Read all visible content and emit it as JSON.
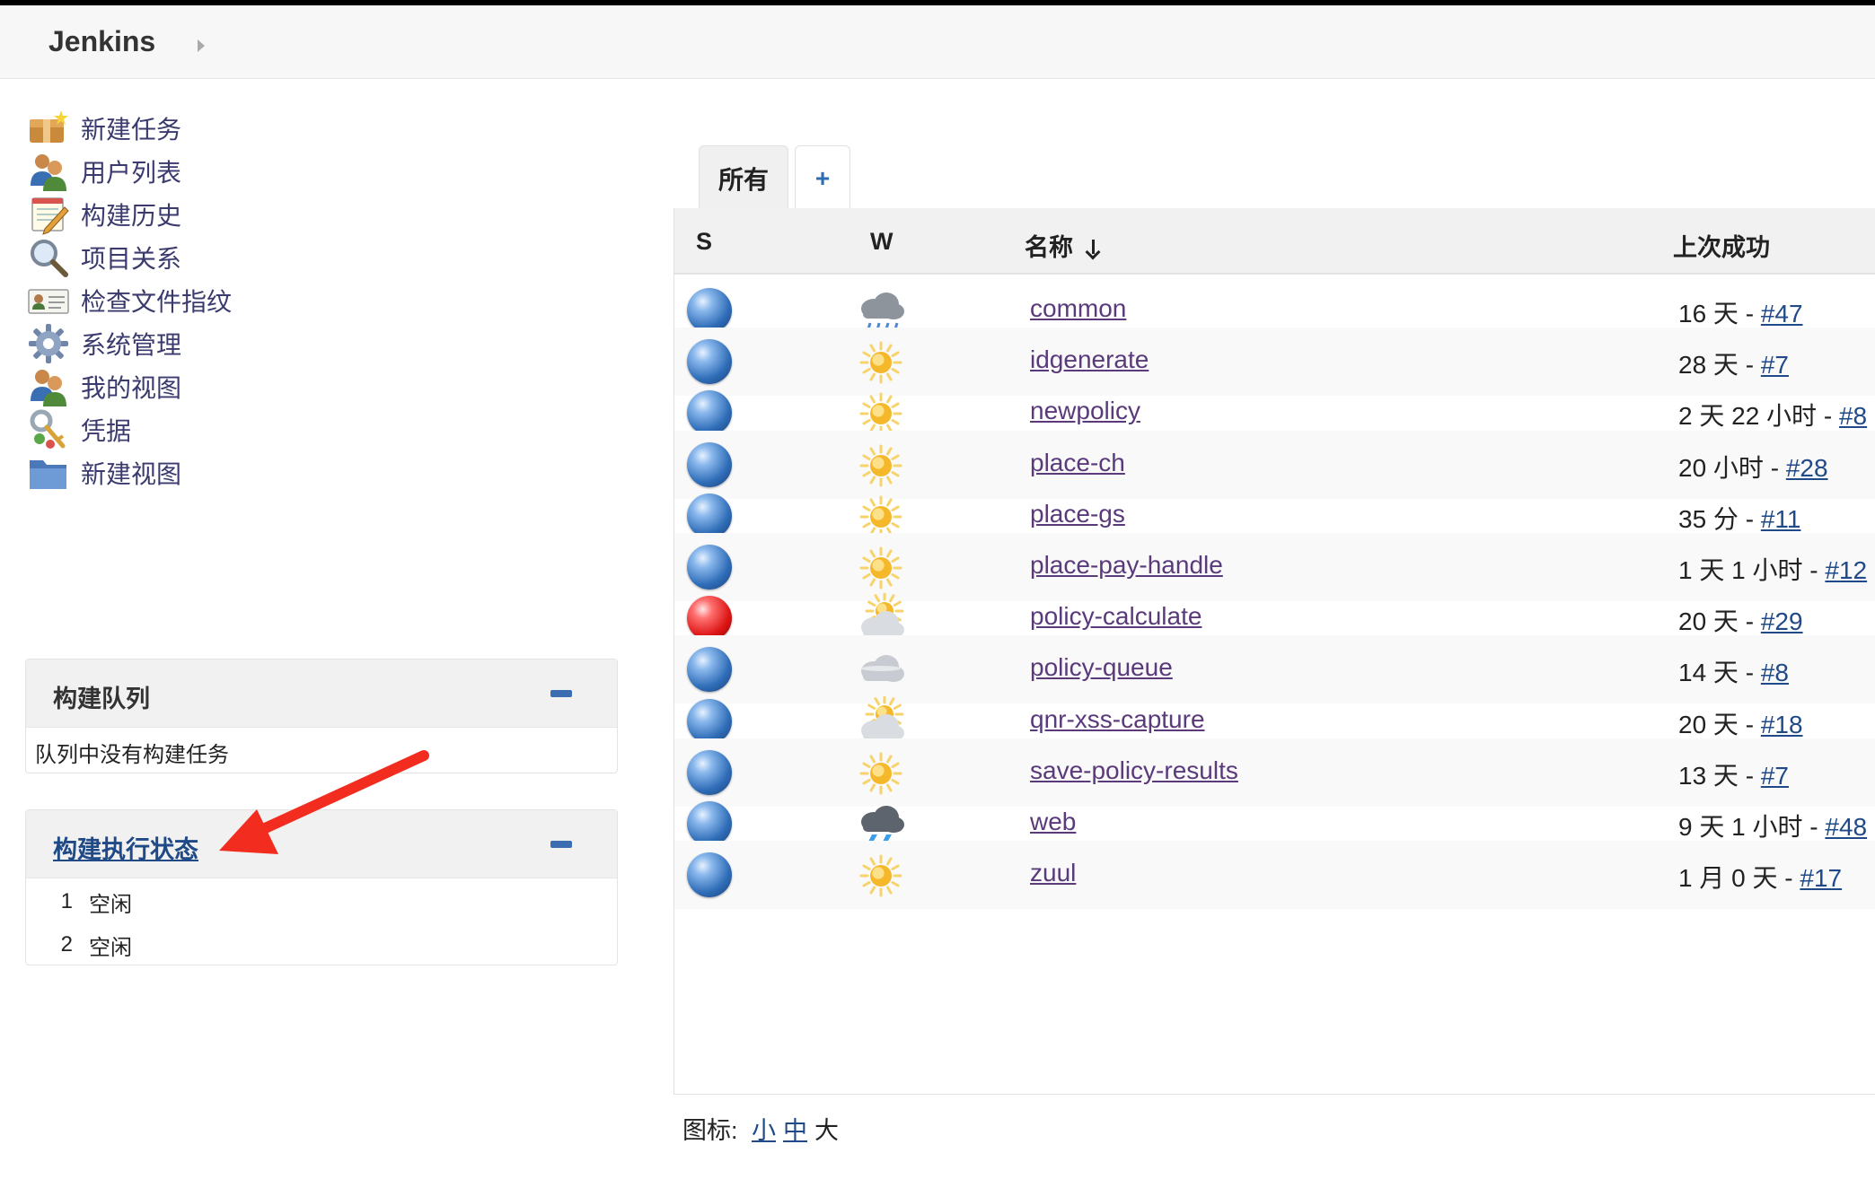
{
  "header": {
    "brand": "Jenkins"
  },
  "sidebar": {
    "tasks": [
      {
        "label": "新建任务",
        "icon": "new-item-icon"
      },
      {
        "label": "用户列表",
        "icon": "users-icon"
      },
      {
        "label": "构建历史",
        "icon": "notepad-icon"
      },
      {
        "label": "项目关系",
        "icon": "magnifier-icon"
      },
      {
        "label": "检查文件指纹",
        "icon": "fingerprint-card-icon"
      },
      {
        "label": "系统管理",
        "icon": "gear-icon"
      },
      {
        "label": "我的视图",
        "icon": "user-view-icon"
      },
      {
        "label": "凭据",
        "icon": "keys-icon"
      },
      {
        "label": "新建视图",
        "icon": "folder-icon"
      }
    ]
  },
  "build_queue": {
    "title": "构建队列",
    "empty_text": "队列中没有构建任务"
  },
  "executors": {
    "title": "构建执行状态",
    "items": [
      {
        "num": "1",
        "status": "空闲"
      },
      {
        "num": "2",
        "status": "空闲"
      }
    ]
  },
  "tabs": {
    "active": "所有",
    "add": "+"
  },
  "table": {
    "headers": {
      "s": "S",
      "w": "W",
      "name": "名称",
      "last_success": "上次成功"
    },
    "rows": [
      {
        "status": "blue",
        "weather": "rain",
        "name": "common",
        "last_time": "16 天 - ",
        "last_build": "#47"
      },
      {
        "status": "blue",
        "weather": "sunny",
        "name": "idgenerate",
        "last_time": "28 天 - ",
        "last_build": "#7"
      },
      {
        "status": "blue",
        "weather": "sunny",
        "name": "newpolicy",
        "last_time": "2 天 22 小时 - ",
        "last_build": "#8"
      },
      {
        "status": "blue",
        "weather": "sunny",
        "name": "place-ch",
        "last_time": "20 小时 - ",
        "last_build": "#28"
      },
      {
        "status": "blue",
        "weather": "sunny",
        "name": "place-gs",
        "last_time": "35 分 - ",
        "last_build": "#11"
      },
      {
        "status": "blue",
        "weather": "sunny",
        "name": "place-pay-handle",
        "last_time": "1 天 1 小时 - ",
        "last_build": "#12"
      },
      {
        "status": "red",
        "weather": "partly-cloudy",
        "name": "policy-calculate",
        "last_time": "20 天 - ",
        "last_build": "#29"
      },
      {
        "status": "blue",
        "weather": "cloudy",
        "name": "policy-queue",
        "last_time": "14 天 - ",
        "last_build": "#8"
      },
      {
        "status": "blue",
        "weather": "partly-cloudy",
        "name": "qnr-xss-capture",
        "last_time": "20 天 - ",
        "last_build": "#18"
      },
      {
        "status": "blue",
        "weather": "sunny",
        "name": "save-policy-results",
        "last_time": "13 天 - ",
        "last_build": "#7"
      },
      {
        "status": "blue",
        "weather": "storm",
        "name": "web",
        "last_time": "9 天 1 小时 - ",
        "last_build": "#48"
      },
      {
        "status": "blue",
        "weather": "sunny",
        "name": "zuul",
        "last_time": "1 月 0 天 - ",
        "last_build": "#17"
      }
    ]
  },
  "legend": {
    "label": "图标:",
    "small": "小",
    "medium": "中",
    "large": "大"
  },
  "colors": {
    "status_blue": "#2f6db8",
    "status_red": "#dd1616",
    "annotation_arrow": "#f22d1f"
  }
}
